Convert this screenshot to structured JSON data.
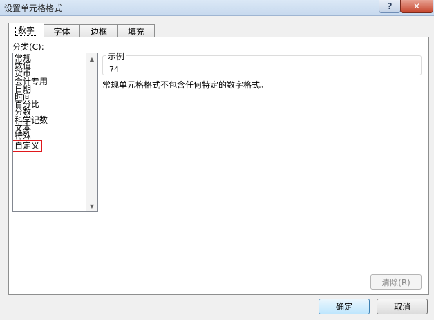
{
  "window": {
    "title": "设置单元格格式",
    "help_label": "?",
    "close_label": "✕"
  },
  "tabs": [
    {
      "label": "数字",
      "active": true
    },
    {
      "label": "字体",
      "active": false
    },
    {
      "label": "边框",
      "active": false
    },
    {
      "label": "填充",
      "active": false
    }
  ],
  "category": {
    "label": "分类(C):",
    "items": [
      "常规",
      "数值",
      "货币",
      "会计专用",
      "日期",
      "时间",
      "百分比",
      "分数",
      "科学记数",
      "文本",
      "特殊",
      "自定义"
    ],
    "highlighted": "自定义",
    "scroll_up": "▲",
    "scroll_down": "▼"
  },
  "sample": {
    "legend": "示例",
    "value": "74"
  },
  "description": "常规单元格格式不包含任何特定的数字格式。",
  "buttons": {
    "delete": "清除(R)",
    "ok": "确定",
    "cancel": "取消"
  }
}
